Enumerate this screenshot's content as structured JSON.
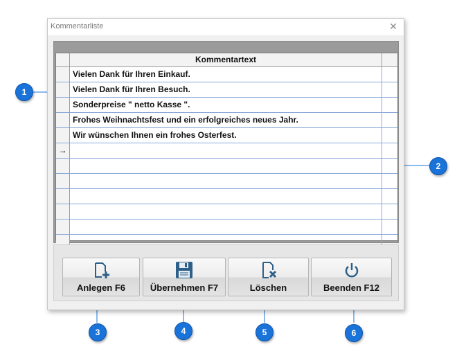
{
  "window": {
    "title": "Kommentarliste",
    "close_glyph": "✕"
  },
  "grid": {
    "column_header": "Kommentartext",
    "current_row_marker": "→",
    "rows": [
      "Vielen Dank für Ihren Einkauf.",
      "Vielen Dank für Ihren Besuch.",
      "Sonderpreise  \" netto Kasse \".",
      "Frohes Weihnachtsfest und ein erfolgreiches neues Jahr.",
      "Wir wünschen Ihnen ein frohes Osterfest.",
      "",
      "",
      "",
      "",
      "",
      "",
      ""
    ],
    "current_row_index": 5
  },
  "buttons": [
    {
      "label": "Anlegen F6",
      "icon": "new-document-icon"
    },
    {
      "label": "Übernehmen F7",
      "icon": "save-floppy-icon"
    },
    {
      "label": "Löschen",
      "icon": "delete-document-icon"
    },
    {
      "label": "Beenden F12",
      "icon": "power-icon"
    }
  ],
  "callouts": [
    "1",
    "2",
    "3",
    "4",
    "5",
    "6"
  ],
  "colors": {
    "callout": "#1a73d9",
    "grid_line": "#88a8d8",
    "icon": "#2d5f88"
  }
}
